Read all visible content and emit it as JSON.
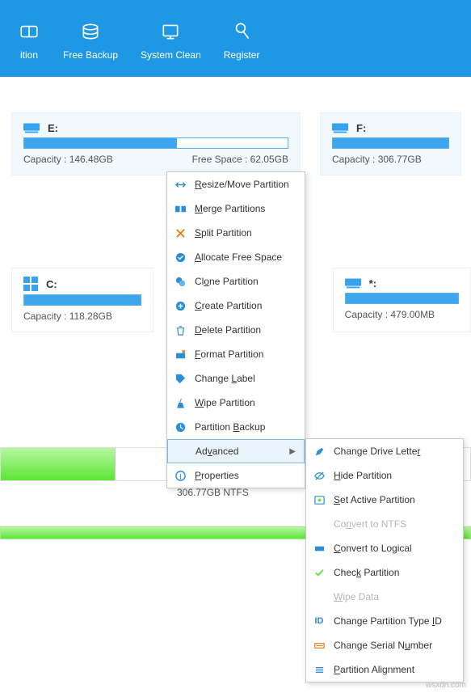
{
  "toolbar": {
    "partition": "ition",
    "free_backup": "Free Backup",
    "system_clean": "System Clean",
    "register": "Register"
  },
  "drives": {
    "e": {
      "label": "E:",
      "capacity": "Capacity : 146.48GB",
      "free": "Free Space : 62.05GB",
      "fill_pct": 58
    },
    "f": {
      "label": "F:",
      "capacity": "Capacity : 306.77GB",
      "fill_pct": 100
    },
    "c": {
      "label": "C:",
      "capacity": "Capacity : 118.28GB",
      "fill_pct": 100
    },
    "star": {
      "label": "*:",
      "capacity": "Capacity : 479.00MB",
      "fill_pct": 100
    }
  },
  "ctx": {
    "resize": "Resize/Move Partition",
    "merge": "Merge Partitions",
    "split": "Split Partition",
    "allocate": "Allocate Free Space",
    "clone": "Clone Partition",
    "create": "Create Partition",
    "delete": "Delete Partition",
    "format": "Format Partition",
    "label": "Change Label",
    "wipe": "Wipe Partition",
    "backup": "Partition Backup",
    "advanced": "Advanced",
    "properties": "Properties"
  },
  "sub": {
    "drive_letter": "Change Drive Letter",
    "hide": "Hide Partition",
    "active": "Set Active Partition",
    "ntfs": "Convert to NTFS",
    "logical": "Convert to Logical",
    "check": "Check Partition",
    "wipe_data": "Wipe Data",
    "type_id": "Change Partition Type ID",
    "serial": "Change Serial Number",
    "align": "Partition Alignment"
  },
  "disk": {
    "seg_label": "306.77GB NTFS"
  },
  "watermark": "wsxdn.com"
}
